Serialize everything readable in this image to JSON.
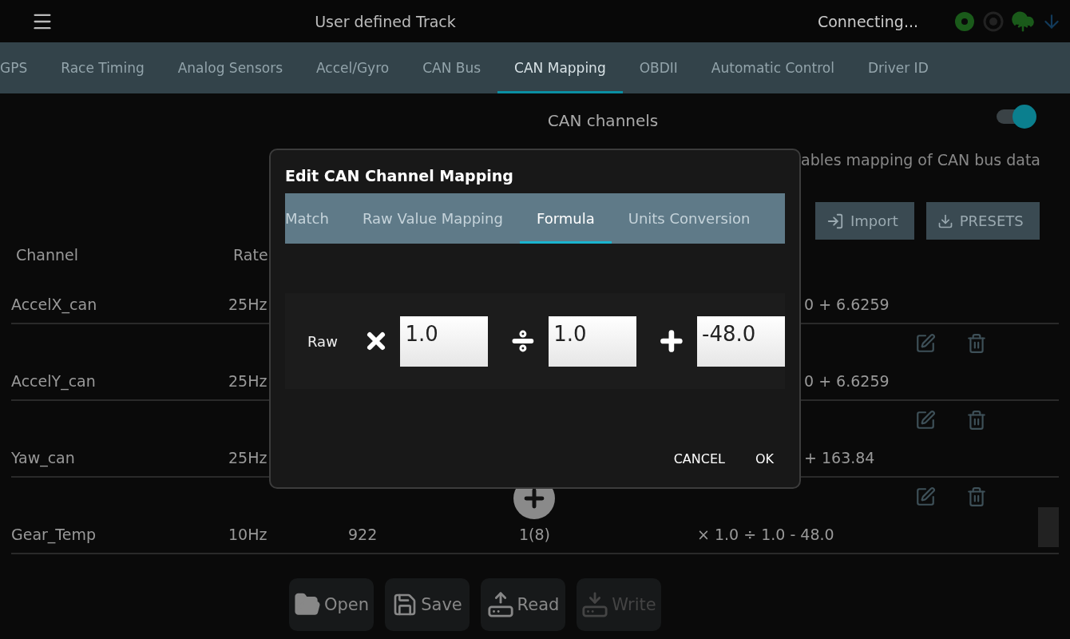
{
  "header": {
    "title": "User defined Track",
    "status": "Connecting..."
  },
  "tabs": [
    {
      "label": "GPS",
      "selected": false
    },
    {
      "label": "Race Timing",
      "selected": false
    },
    {
      "label": "Analog Sensors",
      "selected": false
    },
    {
      "label": "Accel/Gyro",
      "selected": false
    },
    {
      "label": "CAN Bus",
      "selected": false
    },
    {
      "label": "CAN Mapping",
      "selected": true
    },
    {
      "label": "OBDII",
      "selected": false
    },
    {
      "label": "Automatic Control",
      "selected": false
    },
    {
      "label": "Driver ID",
      "selected": false
    }
  ],
  "section": {
    "title": "CAN channels",
    "enabled": true,
    "description": "ables mapping of CAN bus data",
    "buttons": [
      {
        "label": "Import",
        "kind": "import"
      },
      {
        "label": "PRESETS",
        "kind": "presets"
      }
    ]
  },
  "table": {
    "columns": [
      "Channel",
      "Rate"
    ],
    "rows": [
      {
        "channel": "AccelX_can",
        "rate": "25Hz",
        "formula_tail": "0 + 6.6259"
      },
      {
        "channel": "AccelY_can",
        "rate": "25Hz",
        "formula_tail": "0 + 6.6259"
      },
      {
        "channel": "Yaw_can",
        "rate": "25Hz",
        "formula_tail": "+ 163.84"
      },
      {
        "channel": "Gear_Temp",
        "rate": "10Hz",
        "column_3": "922",
        "column_4": "1(8)",
        "formula": "× 1.0 ÷ 1.0 - 48.0"
      }
    ]
  },
  "toolbar": [
    {
      "label": "Open",
      "kind": "open",
      "disabled": false
    },
    {
      "label": "Save",
      "kind": "save",
      "disabled": false
    },
    {
      "label": "Read",
      "kind": "read",
      "disabled": false
    },
    {
      "label": "Write",
      "kind": "write",
      "disabled": true
    }
  ],
  "dialog": {
    "title": "Edit CAN Channel Mapping",
    "tabs": [
      {
        "label": "Match",
        "selected": false
      },
      {
        "label": "Raw Value Mapping",
        "selected": false
      },
      {
        "label": "Formula",
        "selected": true
      },
      {
        "label": "Units Conversion",
        "selected": false
      }
    ],
    "formula": {
      "label": "Raw",
      "multiply": "1.0",
      "divide": "1.0",
      "add": "-48.0"
    },
    "buttons": [
      "CANCEL",
      "OK"
    ]
  }
}
